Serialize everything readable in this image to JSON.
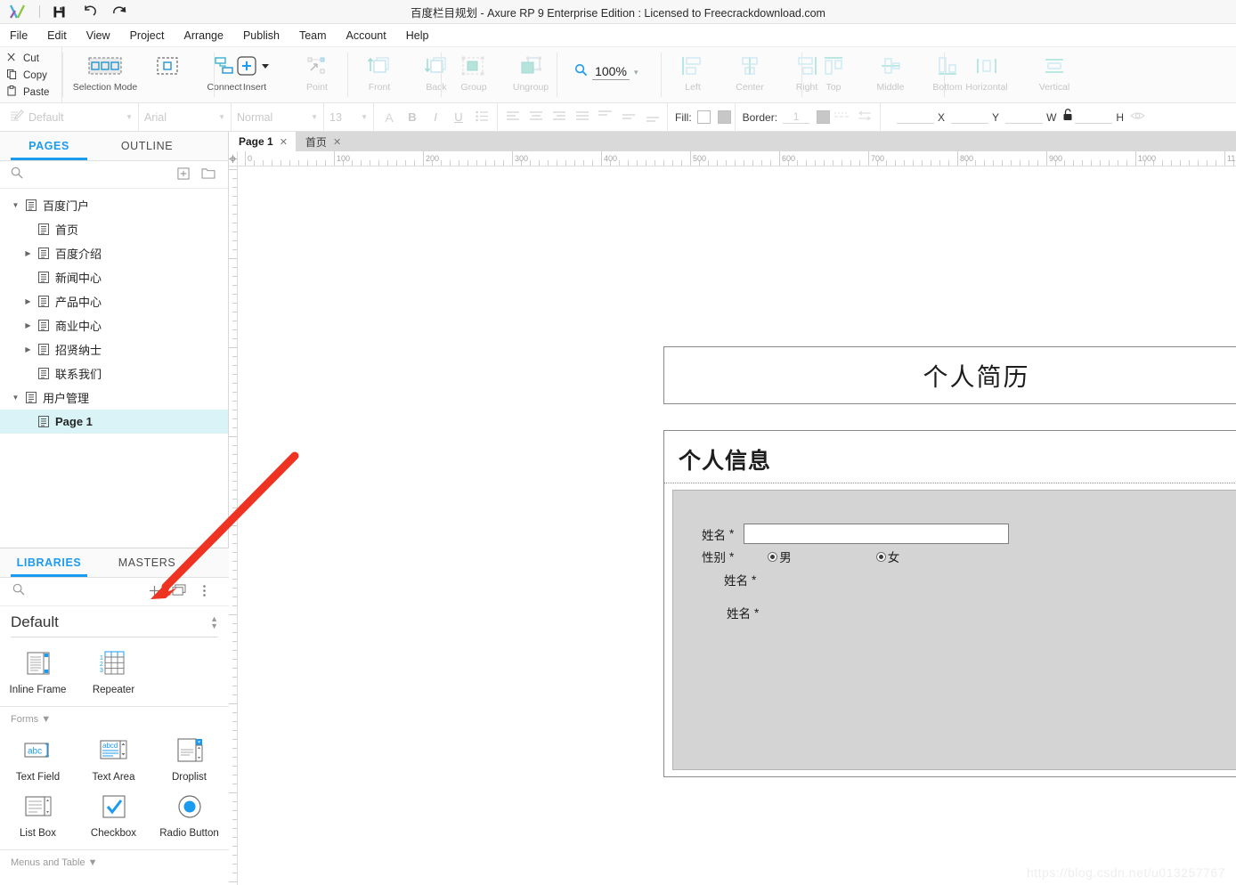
{
  "titlebar": {
    "title": "百度栏目规划 - Axure RP 9 Enterprise Edition : Licensed to Freecrackdownload.com",
    "icons": [
      {
        "name": "save-icon",
        "glyph": "■"
      },
      {
        "name": "undo-icon",
        "glyph": "↶"
      },
      {
        "name": "redo-icon",
        "glyph": "↷"
      }
    ]
  },
  "menu": [
    "File",
    "Edit",
    "View",
    "Project",
    "Arrange",
    "Publish",
    "Team",
    "Account",
    "Help"
  ],
  "clipboard": [
    {
      "label": "Cut",
      "glyph": "✂"
    },
    {
      "label": "Copy",
      "glyph": "❐"
    },
    {
      "label": "Paste",
      "glyph": "Ὄb"
    }
  ],
  "toolbar": {
    "selection_mode": "Selection Mode",
    "connect": "Connect",
    "insert": "Insert",
    "point": "Point",
    "front": "Front",
    "back": "Back",
    "group": "Group",
    "ungroup": "Ungroup",
    "zoom_value": "100%",
    "align": [
      "Left",
      "Center",
      "Right"
    ],
    "valign": [
      "Top",
      "Middle",
      "Bottom"
    ],
    "distribute": [
      "Horizontal",
      "Vertical"
    ]
  },
  "formatbar": {
    "style": "Default",
    "font": "Arial",
    "weight": "Normal",
    "size": "13",
    "fill_label": "Fill:",
    "border_label": "Border:",
    "border_value": "1",
    "x_label": "X",
    "y_label": "Y",
    "w_label": "W",
    "h_label": "H"
  },
  "left_panel": {
    "tabs": [
      {
        "label": "PAGES",
        "active": true
      },
      {
        "label": "OUTLINE",
        "active": false
      }
    ],
    "search_placeholder": "",
    "tree": [
      {
        "label": "百度门户",
        "depth": 0,
        "twisty": "down",
        "selected": false
      },
      {
        "label": "首页",
        "depth": 1,
        "twisty": "none",
        "selected": false
      },
      {
        "label": "百度介绍",
        "depth": 1,
        "twisty": "right",
        "selected": false
      },
      {
        "label": "新闻中心",
        "depth": 1,
        "twisty": "none",
        "selected": false
      },
      {
        "label": "产品中心",
        "depth": 1,
        "twisty": "right",
        "selected": false
      },
      {
        "label": "商业中心",
        "depth": 1,
        "twisty": "right",
        "selected": false
      },
      {
        "label": "招贤纳士",
        "depth": 1,
        "twisty": "right",
        "selected": false
      },
      {
        "label": "联系我们",
        "depth": 1,
        "twisty": "none",
        "selected": false
      },
      {
        "label": "用户管理",
        "depth": 0,
        "twisty": "down",
        "selected": false
      },
      {
        "label": "Page 1",
        "depth": 1,
        "twisty": "none",
        "selected": true
      }
    ]
  },
  "libraries_panel": {
    "tabs": [
      {
        "label": "LIBRARIES",
        "active": true
      },
      {
        "label": "MASTERS",
        "active": false
      }
    ],
    "library_name": "Default",
    "sections": [
      {
        "title": "",
        "widgets": [
          {
            "label": "Inline Frame",
            "icon": "inline-frame-icon"
          },
          {
            "label": "Repeater",
            "icon": "repeater-icon"
          }
        ]
      },
      {
        "title": "Forms ▼",
        "widgets": [
          {
            "label": "Text Field",
            "icon": "text-field-icon"
          },
          {
            "label": "Text Area",
            "icon": "text-area-icon"
          },
          {
            "label": "Droplist",
            "icon": "droplist-icon"
          },
          {
            "label": "List Box",
            "icon": "list-box-icon"
          },
          {
            "label": "Checkbox",
            "icon": "checkbox-icon"
          },
          {
            "label": "Radio Button",
            "icon": "radio-button-icon"
          }
        ]
      }
    ],
    "footer_section": "Menus and Table ▼"
  },
  "canvas": {
    "tabs": [
      {
        "label": "Page 1",
        "active": true
      },
      {
        "label": "首页",
        "active": false
      }
    ],
    "ruler_h_labels": [
      "0",
      "100",
      "200",
      "300",
      "400",
      "500",
      "600",
      "700",
      "800",
      "900",
      "1000",
      "11"
    ],
    "ruler_v_labels": [
      "0",
      "100",
      "200",
      "300",
      "400",
      "500",
      "600",
      "700",
      "8"
    ]
  },
  "resume": {
    "title": "个人简历",
    "section_title": "个人信息",
    "fields": [
      {
        "label": "姓名",
        "required": "*",
        "type": "text"
      },
      {
        "label": "性别",
        "required": "*",
        "type": "radio",
        "options": [
          {
            "label": "男",
            "selected": true
          },
          {
            "label": "女",
            "selected": true
          }
        ]
      },
      {
        "label": "姓名",
        "required": "*",
        "type": "label"
      },
      {
        "label": "姓名",
        "required": "*",
        "type": "label"
      }
    ]
  },
  "watermark": "https://blog.csdn.net/u013257767",
  "colors": {
    "accent": "#1b9bf0",
    "selection": "#d9f3f7",
    "toolbar_bg": "#fbfbfb",
    "panel_grey": "#d4d4d4",
    "annotation_red": "#ee3322"
  }
}
